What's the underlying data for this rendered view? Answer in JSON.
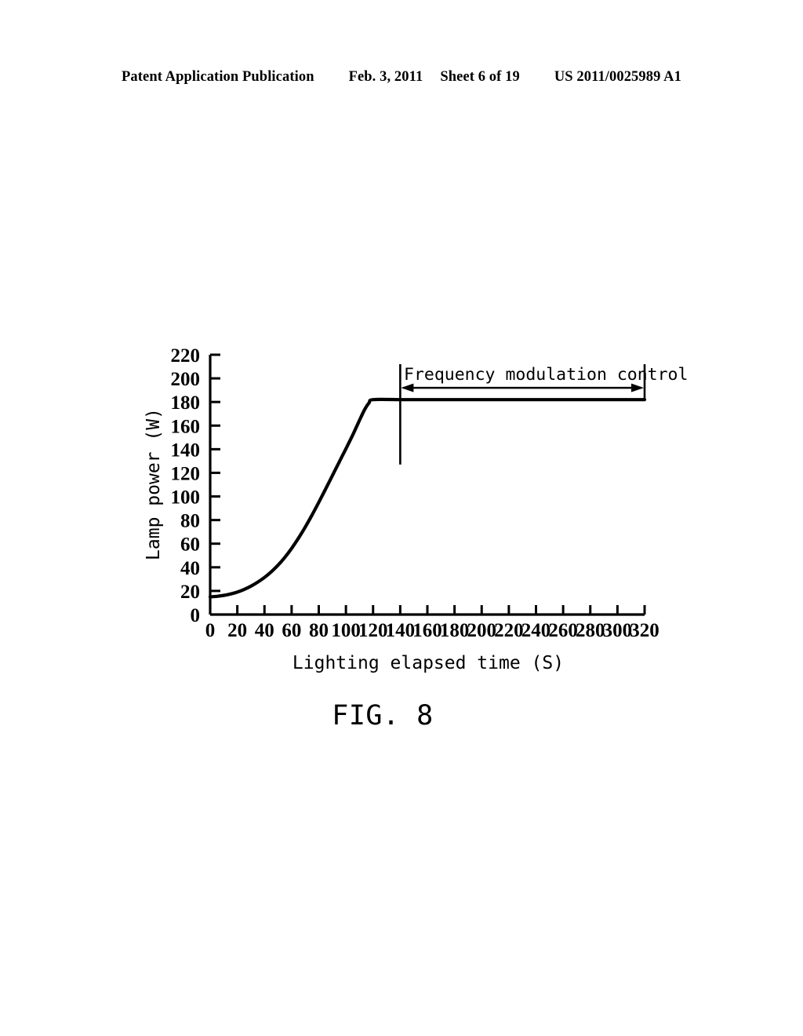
{
  "header": {
    "publication": "Patent Application Publication",
    "date": "Feb. 3, 2011",
    "sheet": "Sheet 6 of 19",
    "docnum": "US 2011/0025989 A1"
  },
  "figure": {
    "caption": "FIG. 8",
    "annotation_label": "Frequency modulation control"
  },
  "chart_data": {
    "type": "line",
    "title": "",
    "xlabel": "Lighting elapsed time (S)",
    "ylabel": "Lamp power (W)",
    "xlim": [
      0,
      320
    ],
    "ylim": [
      0,
      220
    ],
    "xticks": [
      0,
      20,
      40,
      60,
      80,
      100,
      120,
      140,
      160,
      180,
      200,
      220,
      240,
      260,
      280,
      300,
      320
    ],
    "yticks": [
      0,
      20,
      40,
      60,
      80,
      100,
      120,
      140,
      160,
      180,
      200,
      220
    ],
    "grid": false,
    "legend": null,
    "series": [
      {
        "name": "Lamp power",
        "x": [
          0,
          5,
          10,
          15,
          20,
          25,
          30,
          35,
          40,
          45,
          50,
          55,
          60,
          65,
          70,
          75,
          80,
          85,
          90,
          95,
          100,
          105,
          108,
          111,
          114,
          117,
          120,
          140,
          160,
          180,
          200,
          220,
          240,
          260,
          280,
          300,
          320
        ],
        "y": [
          15,
          15.4,
          16.2,
          17.4,
          19.0,
          21.2,
          24.0,
          27.4,
          31.4,
          36.2,
          41.8,
          48.4,
          56.0,
          64.6,
          74.0,
          84.2,
          95.0,
          106.2,
          117.6,
          129.0,
          140.4,
          152.0,
          159.5,
          167.0,
          174.0,
          179.2,
          182.0,
          182.0,
          182.0,
          182.0,
          182.0,
          182.0,
          182.0,
          182.0,
          182.0,
          182.0,
          182.0
        ]
      }
    ],
    "annotations": [
      {
        "text": "Frequency modulation control",
        "type": "span-arrow",
        "x_start": 140,
        "x_end": 320,
        "y": 192,
        "marker_line_x": 140,
        "marker_line_y_from": 127,
        "marker_line_y_to": 212
      }
    ]
  }
}
